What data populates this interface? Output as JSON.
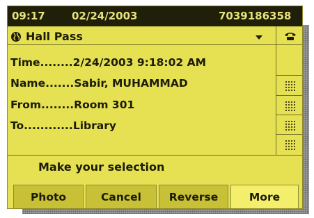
{
  "status_bar": {
    "time": "09:17",
    "date": "02/24/2003",
    "number": "7039186358"
  },
  "title_bar": {
    "title": "Hall Pass",
    "title_icon": "globe-icon",
    "dropdown_icon": "chevron-down-icon",
    "line_icon": "phone-icon"
  },
  "fields": [
    {
      "label": "Time........",
      "value": "2/24/2003 9:18:02 AM"
    },
    {
      "label": "Name.......",
      "value": "Sabir, MUHAMMAD"
    },
    {
      "label": "From........",
      "value": "Room 301"
    },
    {
      "label": "To............",
      "value": "Library"
    }
  ],
  "prompt": "Make your selection",
  "softkeys": [
    {
      "label": "Photo"
    },
    {
      "label": "Cancel"
    },
    {
      "label": "Reverse"
    },
    {
      "label": "More"
    }
  ],
  "colors": {
    "screen": "#e6e152",
    "status_bar": "#1f1f0a",
    "status_text": "#e8e27a",
    "softkey": "#c8c036",
    "softkey_selected": "#f3ef6c"
  }
}
